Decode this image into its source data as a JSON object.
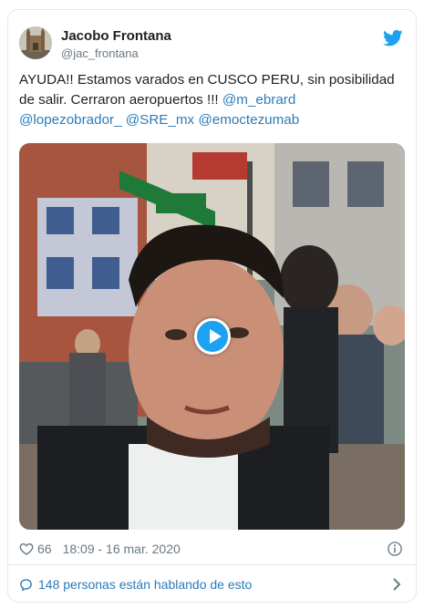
{
  "tweet": {
    "author_name": "Jacobo Frontana",
    "author_handle": "@jac_frontana",
    "text_plain": "AYUDA!! Estamos varados en CUSCO PERU, sin posibilidad de salir. Cerraron aeropuertos !!! ",
    "mentions": [
      "@m_ebrard",
      "@lopezobrador_",
      "@SRE_mx",
      "@emoctezumab"
    ],
    "likes": "66",
    "timestamp": "18:09 - 16 mar. 2020",
    "conversation_link": "148 personas están hablando de esto"
  },
  "colors": {
    "brand": "#1da1f2",
    "link": "#2b7bb9",
    "muted": "#697882",
    "border": "#e1e8ed"
  },
  "icons": [
    "twitter-bird-icon",
    "heart-icon",
    "info-icon",
    "speech-bubble-icon",
    "chevron-right-icon",
    "play-icon"
  ]
}
